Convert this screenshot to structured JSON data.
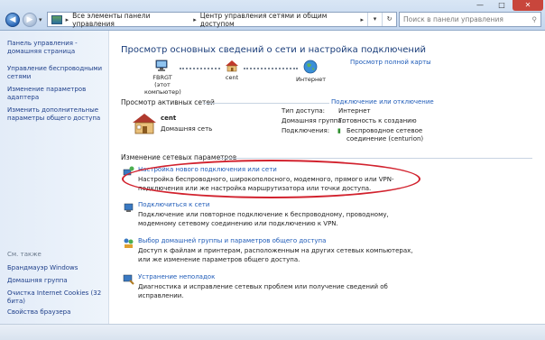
{
  "address": {
    "crumbs": [
      "Все элементы панели управления",
      "Центр управления сетями и общим доступом"
    ],
    "search_placeholder": "Поиск в панели управления"
  },
  "sidebar": {
    "links": [
      "Панель управления - домашняя страница",
      "Управление беспроводными сетями",
      "Изменение параметров адаптера",
      "Изменить дополнительные параметры общего доступа"
    ],
    "see_also_title": "См. также",
    "see_also": [
      "Брандмауэр Windows",
      "Домашняя группа",
      "Очистка Internet Cookies (32 бита)",
      "Свойства браузера"
    ]
  },
  "main": {
    "heading": "Просмотр основных сведений о сети и настройка подключений",
    "full_map": "Просмотр полной карты",
    "map": {
      "computer_name": "FBRGT",
      "computer_sub": "(этот компьютер)",
      "network_name": "cent",
      "internet": "Интернет"
    },
    "active_networks_label": "Просмотр активных сетей",
    "connect_disconnect": "Подключение или отключение",
    "network": {
      "name": "cent",
      "type": "Домашняя сеть",
      "access_type_label": "Тип доступа:",
      "access_type_value": "Интернет",
      "homegroup_label": "Домашняя группа:",
      "homegroup_value": "Готовность к созданию",
      "connections_label": "Подключения:",
      "connections_value": "Беспроводное сетевое соединение (centurion)"
    },
    "change_settings_label": "Изменение сетевых параметров",
    "tasks": [
      {
        "title": "Настройка нового подключения или сети",
        "desc": "Настройка беспроводного, широкополосного, модемного, прямого или VPN-подключения или же настройка маршрутизатора или точки доступа."
      },
      {
        "title": "Подключиться к сети",
        "desc": "Подключение или повторное подключение к беспроводному, проводному, модемному сетевому соединению или подключению к VPN."
      },
      {
        "title": "Выбор домашней группы и параметров общего доступа",
        "desc": "Доступ к файлам и принтерам, расположенным на других сетевых компьютерах, или же изменение параметров общего доступа."
      },
      {
        "title": "Устранение неполадок",
        "desc": "Диагностика и исправление сетевых проблем или получение сведений об исправлении."
      }
    ]
  },
  "colors": {
    "link": "#1e5bb8",
    "heading": "#1a3d7a",
    "highlight": "#d2222e"
  }
}
